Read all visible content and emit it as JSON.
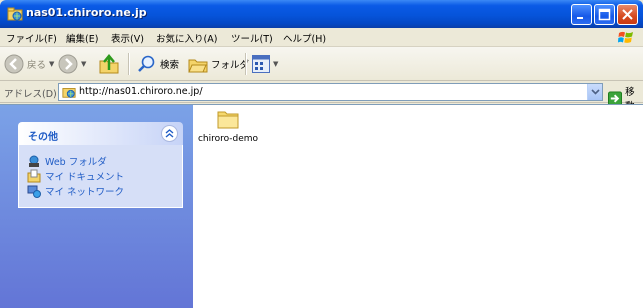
{
  "window": {
    "title": "nas01.chiroro.ne.jp",
    "icon": "web-folder-icon"
  },
  "menubar": {
    "items": [
      "ファイル(F)",
      "編集(E)",
      "表示(V)",
      "お気に入り(A)",
      "ツール(T)",
      "ヘルプ(H)"
    ]
  },
  "toolbar": {
    "back_label": "戻る",
    "search_label": "検索",
    "folders_label": "フォルダ"
  },
  "addressbar": {
    "label": "アドレス(D)",
    "value": "http://nas01.chiroro.ne.jp/",
    "go_label": "移動"
  },
  "taskpane": {
    "title": "その他",
    "links": [
      {
        "label": "Web フォルダ",
        "icon": "web-folder-icon"
      },
      {
        "label": "マイ ドキュメント",
        "icon": "my-documents-icon"
      },
      {
        "label": "マイ ネットワーク",
        "icon": "my-network-icon"
      }
    ]
  },
  "files": [
    {
      "name": "chiroro-demo",
      "icon": "folder-icon"
    }
  ],
  "colors": {
    "titlebar": "#0a5ae6",
    "taskpane_bg": "#6f8ee0",
    "link": "#215dc6"
  }
}
